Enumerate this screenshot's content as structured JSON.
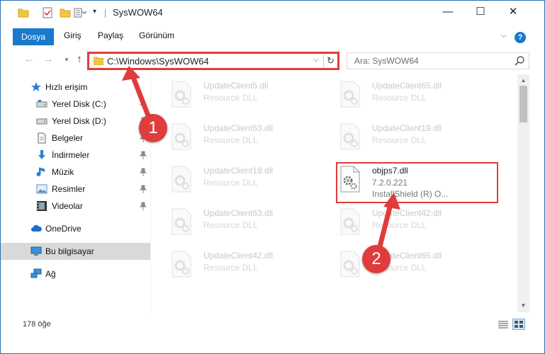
{
  "window": {
    "title": "SysWOW64",
    "controls": {
      "minimize": "—",
      "maximize": "☐",
      "close": "✕"
    }
  },
  "ribbon": {
    "tabs": [
      {
        "label": "Dosya",
        "active": true
      },
      {
        "label": "Giriş"
      },
      {
        "label": "Paylaş"
      },
      {
        "label": "Görünüm"
      }
    ],
    "help": "?"
  },
  "address": {
    "path": "C:\\Windows\\SysWOW64",
    "refresh_glyph": "↻",
    "dropdown_glyph": "⌵"
  },
  "search": {
    "placeholder": "Ara: SysWOW64"
  },
  "sidebar": {
    "items": [
      {
        "label": "Hızlı erişim",
        "icon": "star-icon",
        "pinned": false
      },
      {
        "label": "Yerel Disk (C:)",
        "icon": "drive-icon",
        "pinned": true
      },
      {
        "label": "Yerel Disk (D:)",
        "icon": "drive-icon",
        "pinned": true
      },
      {
        "label": "Belgeler",
        "icon": "documents-icon",
        "pinned": true
      },
      {
        "label": "İndirmeler",
        "icon": "downloads-icon",
        "pinned": true
      },
      {
        "label": "Müzik",
        "icon": "music-icon",
        "pinned": true
      },
      {
        "label": "Resimler",
        "icon": "pictures-icon",
        "pinned": true
      },
      {
        "label": "Videolar",
        "icon": "videos-icon",
        "pinned": true
      },
      {
        "label": "OneDrive",
        "icon": "cloud-icon",
        "pinned": false
      },
      {
        "label": "Bu bilgisayar",
        "icon": "computer-icon",
        "pinned": false,
        "selected": true
      },
      {
        "label": "Ağ",
        "icon": "network-icon",
        "pinned": false
      }
    ]
  },
  "files": [
    {
      "name": "UpdateClient5.dll",
      "desc": "Resource DLL",
      "faded": true
    },
    {
      "name": "UpdateClient65.dll",
      "desc": "Resource DLL",
      "faded": true
    },
    {
      "name": "UpdateClient63.dll",
      "desc": "Resource DLL",
      "faded": true
    },
    {
      "name": "UpdateClient19.dll",
      "desc": "Resource DLL",
      "faded": true
    },
    {
      "name": "UpdateClient19.dll",
      "desc": "Resource DLL",
      "faded": true
    },
    {
      "name": "objps7.dll",
      "version": "7.2.0.221",
      "desc": "InstallShield (R) O...",
      "faded": false
    },
    {
      "name": "UpdateClient63.dll",
      "desc": "Resource DLL",
      "faded": true
    },
    {
      "name": "UpdateClient42.dll",
      "desc": "Resource DLL",
      "faded": true
    },
    {
      "name": "UpdateClient42.dll",
      "desc": "Resource DLL",
      "faded": true
    },
    {
      "name": "UpdateClient65.dll",
      "desc": "Resource DLL",
      "faded": true
    }
  ],
  "status": {
    "count": "178 öğe"
  },
  "annotations": {
    "step1": "1",
    "step2": "2",
    "color": "#e03c3c"
  }
}
